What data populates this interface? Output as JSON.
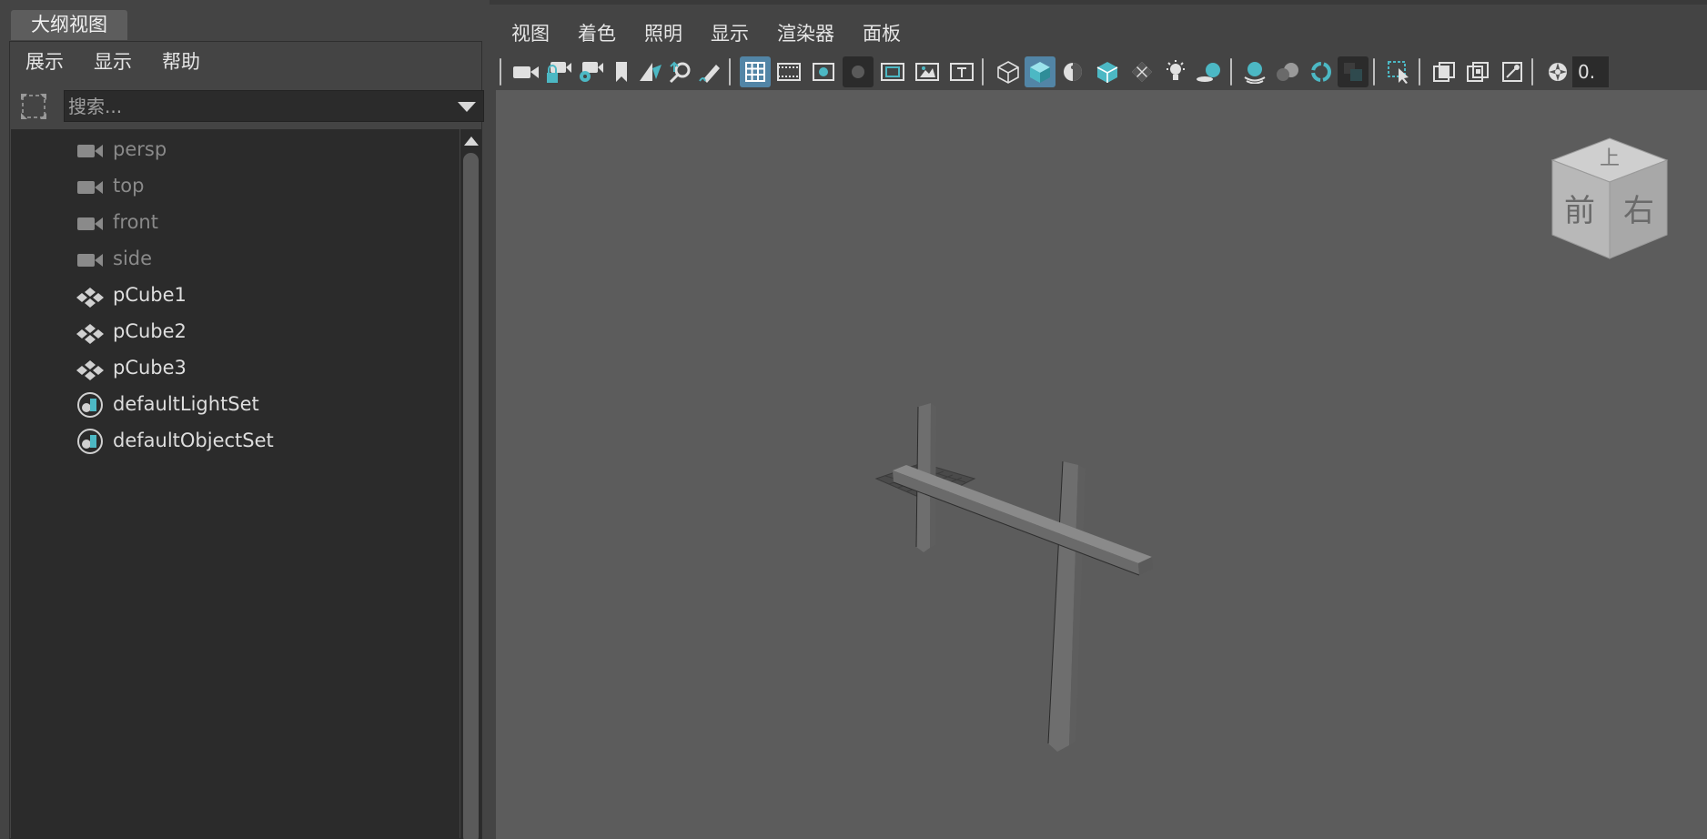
{
  "outliner": {
    "tab_title": "大纲视图",
    "menu": [
      "展示",
      "显示",
      "帮助"
    ],
    "search_placeholder": "搜索...",
    "items": [
      {
        "label": "persp",
        "icon": "camera-icon",
        "dimmed": true
      },
      {
        "label": "top",
        "icon": "camera-icon",
        "dimmed": true
      },
      {
        "label": "front",
        "icon": "camera-icon",
        "dimmed": true
      },
      {
        "label": "side",
        "icon": "camera-icon",
        "dimmed": true
      },
      {
        "label": "pCube1",
        "icon": "transform-icon",
        "dimmed": false
      },
      {
        "label": "pCube2",
        "icon": "transform-icon",
        "dimmed": false
      },
      {
        "label": "pCube3",
        "icon": "transform-icon",
        "dimmed": false
      },
      {
        "label": "defaultLightSet",
        "icon": "set-icon",
        "dimmed": false
      },
      {
        "label": "defaultObjectSet",
        "icon": "set-icon",
        "dimmed": false
      }
    ]
  },
  "viewport": {
    "menu": [
      "视图",
      "着色",
      "照明",
      "显示",
      "渲染器",
      "面板"
    ],
    "toolbar_field_value": "0.",
    "viewcube": {
      "top": "上",
      "front": "前",
      "right": "右"
    }
  },
  "colors": {
    "accent": "#5285a6",
    "icon_cyan": "#4cb8c4",
    "viewport_bg": "#5c5c5c",
    "panel_bg": "#444444",
    "tree_bg": "#2b2b2b"
  }
}
